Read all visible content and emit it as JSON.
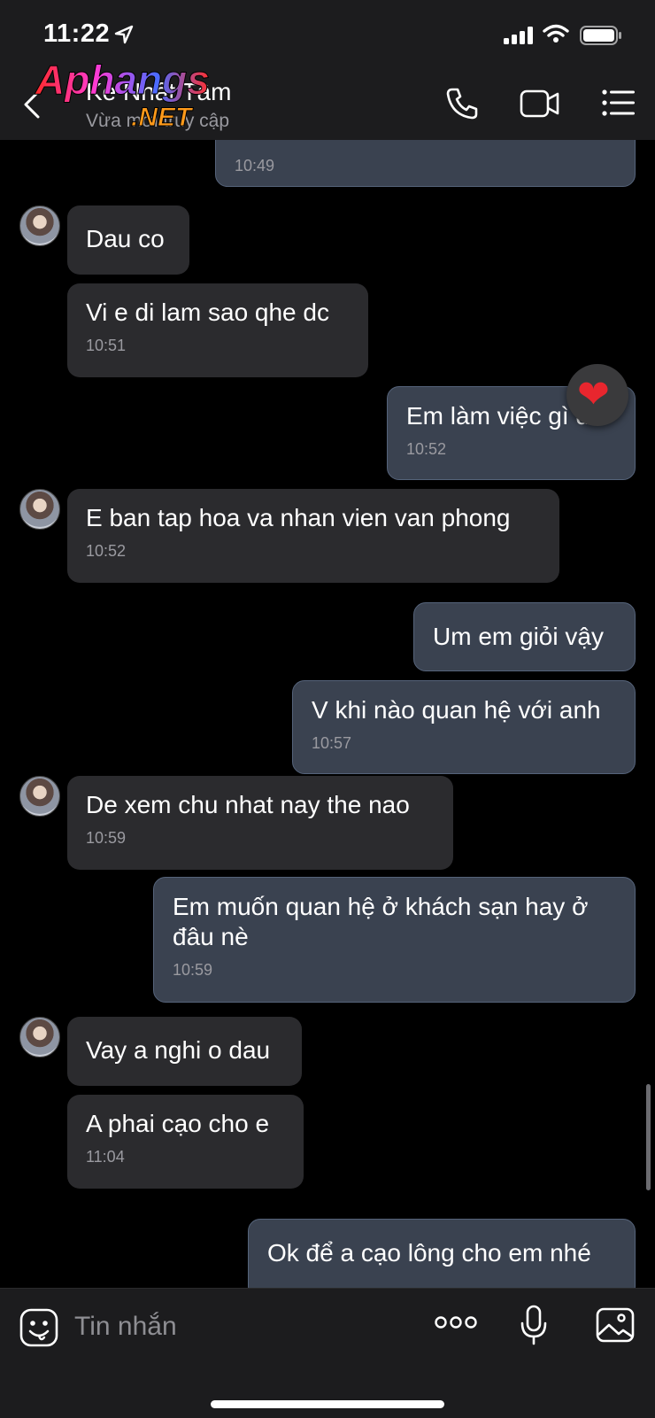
{
  "status_bar": {
    "time": "11:22"
  },
  "header": {
    "contact_name": "Kẻ Nhất Tâm",
    "contact_status": "Vừa mới truy cập",
    "watermark": {
      "brand": "Aphangs",
      "suffix": ".NET"
    }
  },
  "messages": [
    {
      "dir": "out",
      "text": "",
      "time": "10:49"
    },
    {
      "dir": "in",
      "text": "Dau co",
      "time": ""
    },
    {
      "dir": "in",
      "text": "Vi e di lam sao qhe dc",
      "time": "10:51"
    },
    {
      "dir": "out",
      "text": "Em làm việc gì đó",
      "time": "10:52",
      "reaction": "❤"
    },
    {
      "dir": "in",
      "text": "E ban tap hoa va nhan vien van phong",
      "time": "10:52"
    },
    {
      "dir": "out",
      "text": "Um em giỏi vậy",
      "time": ""
    },
    {
      "dir": "out",
      "text": "V khi nào quan hệ với anh",
      "time": "10:57"
    },
    {
      "dir": "in",
      "text": "De xem chu nhat nay the nao",
      "time": "10:59"
    },
    {
      "dir": "out",
      "text": "Em muốn quan hệ ở khách sạn hay ở đâu nè",
      "time": "10:59"
    },
    {
      "dir": "in",
      "text": "Vay a nghi o dau",
      "time": ""
    },
    {
      "dir": "in",
      "text": "A phai cạo cho e",
      "time": "11:04"
    },
    {
      "dir": "out",
      "text": "Ok để a cạo lông cho em nhé",
      "time": ""
    }
  ],
  "composer": {
    "placeholder": "Tin nhắn"
  },
  "icons": {
    "back": "chevron-left-icon",
    "call": "phone-icon",
    "video": "video-camera-icon",
    "menu": "list-menu-icon",
    "emoji": "emoji-sticker-icon",
    "more": "more-dots-icon",
    "mic": "microphone-icon",
    "photo": "image-icon"
  },
  "colors": {
    "background": "#000000",
    "incoming_bubble": "#2b2b2e",
    "outgoing_bubble": "#3a4250",
    "heart": "#e8262e"
  }
}
